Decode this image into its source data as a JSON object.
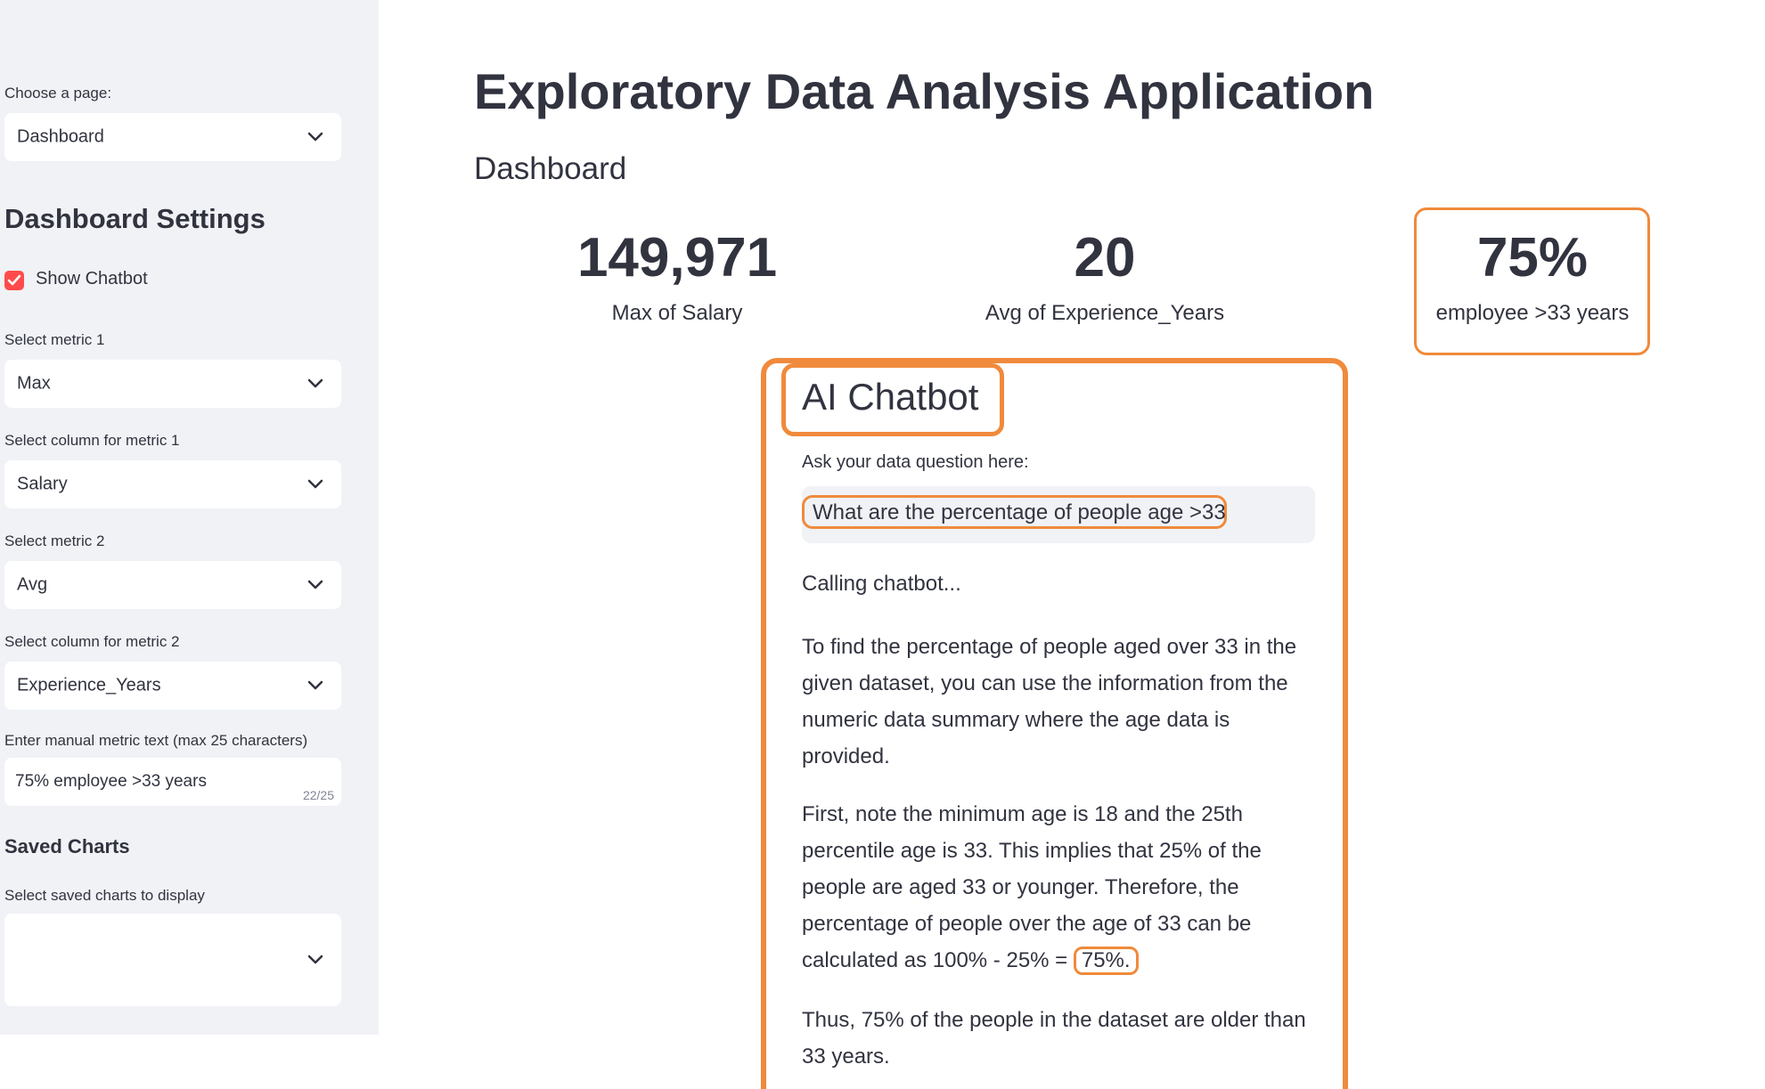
{
  "sidebar": {
    "page_label": "Choose a page:",
    "page_value": "Dashboard",
    "settings_heading": "Dashboard Settings",
    "show_chatbot_label": "Show Chatbot",
    "show_chatbot_checked": true,
    "metric1_label": "Select metric 1",
    "metric1_value": "Max",
    "column1_label": "Select column for metric 1",
    "column1_value": "Salary",
    "metric2_label": "Select metric 2",
    "metric2_value": "Avg",
    "column2_label": "Select column for metric 2",
    "column2_value": "Experience_Years",
    "manual_label": "Enter manual metric text (max 25 characters)",
    "manual_value": "75% employee >33 years",
    "manual_counter": "22/25",
    "saved_heading": "Saved Charts",
    "saved_label": "Select saved charts to display",
    "saved_value": ""
  },
  "main": {
    "title": "Exploratory Data Analysis Application",
    "subtitle": "Dashboard",
    "metrics": [
      {
        "value": "149,971",
        "label": "Max of Salary"
      },
      {
        "value": "20",
        "label": "Avg of Experience_Years"
      },
      {
        "value": "75%",
        "label": "employee >33 years"
      }
    ]
  },
  "chatbot": {
    "title": "AI Chatbot",
    "input_label": "Ask your data question here:",
    "input_value": "What are the percentage of people age >33",
    "status": "Calling chatbot...",
    "para1": "To find the percentage of people aged over 33 in the given dataset, you can use the information from the numeric data summary where the age data is provided.",
    "para2_text": "First, note the minimum age is 18 and the 25th percentile age is 33. This implies that 25% of the people are aged 33 or younger. Therefore, the percentage of people over the age of 33 can be calculated as 100% - 25% =",
    "para2_highlight": "75%.",
    "para3": "Thus, 75% of the people in the dataset are older than 33 years."
  },
  "colors": {
    "accent": "#ff4b4b",
    "highlight": "#f08a3c",
    "sidebar_bg": "#f0f2f6",
    "text": "#31333f"
  }
}
